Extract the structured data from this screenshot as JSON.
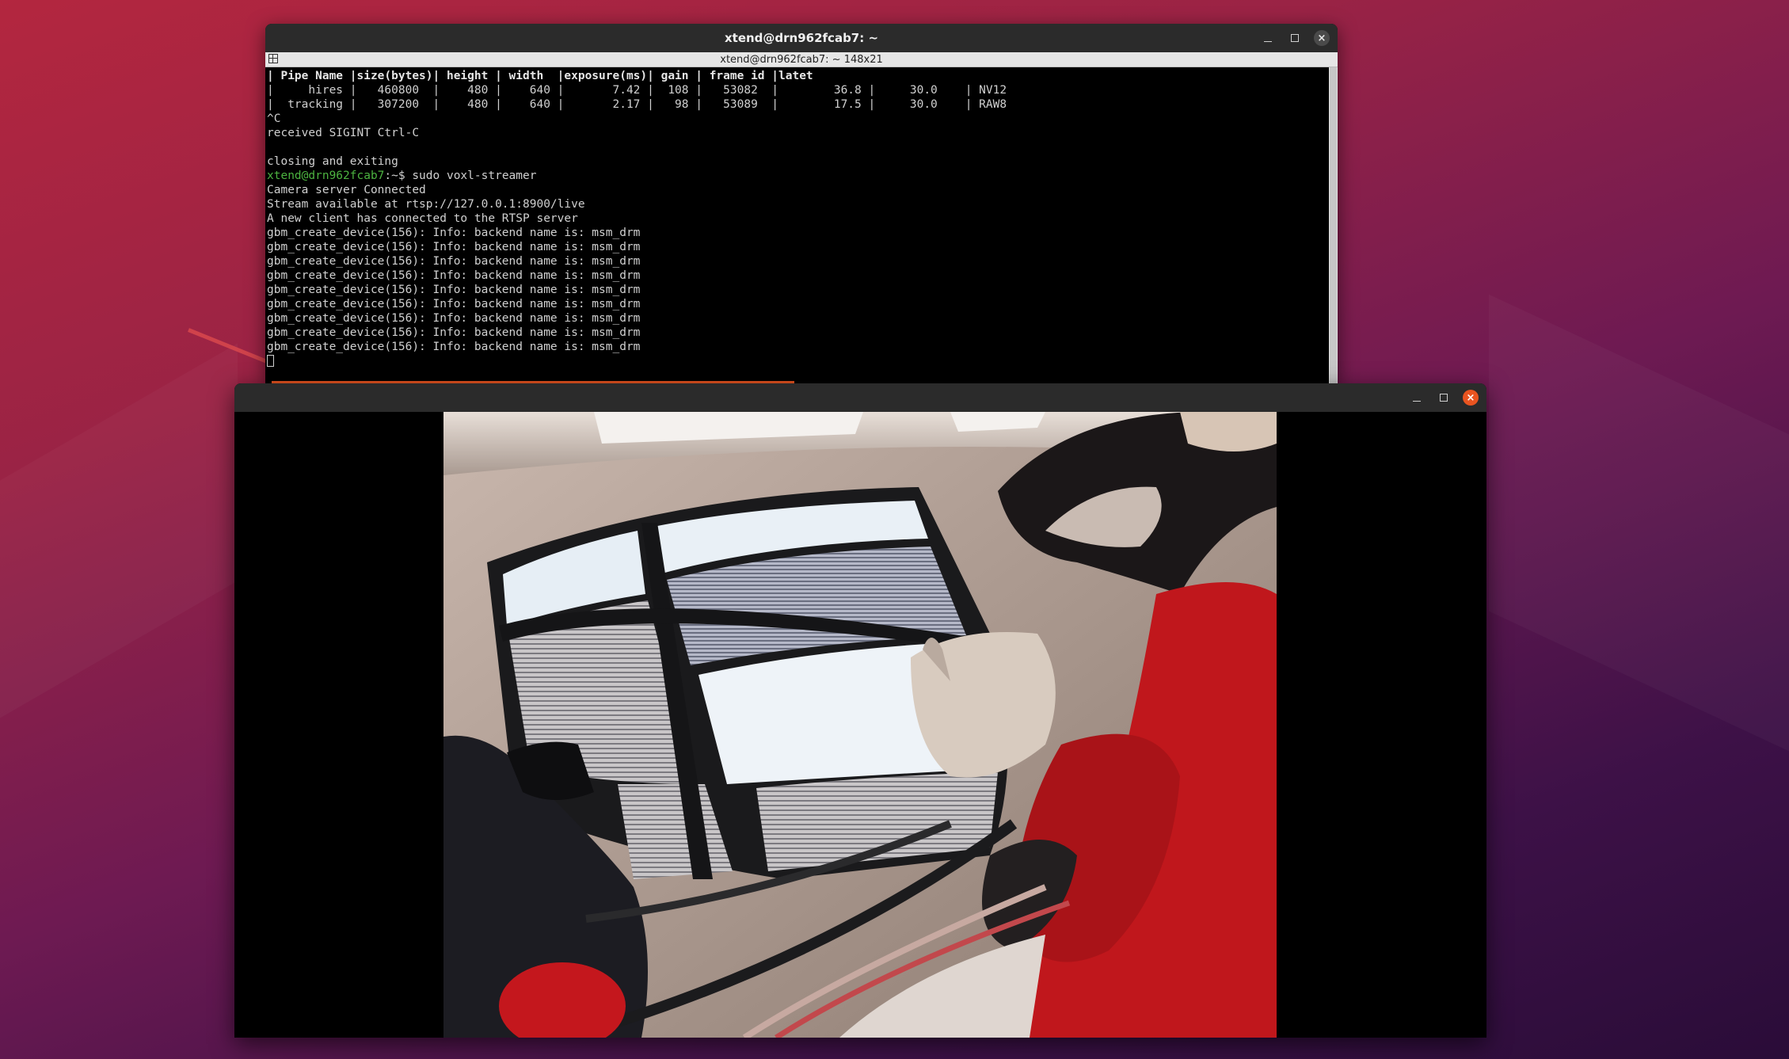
{
  "terminal": {
    "title": "xtend@drn962fcab7: ~",
    "subtitle": "xtend@drn962fcab7: ~ 148x21",
    "table_header": "| Pipe Name |size(bytes)| height | width  |exposure(ms)| gain | frame id |latet",
    "table_rows": [
      "|     hires |   460800  |    480 |    640 |       7.42 |  108 |   53082  |        36.8 |     30.0    | NV12",
      "|  tracking |   307200  |    480 |    640 |       2.17 |   98 |   53089  |        17.5 |     30.0    | RAW8"
    ],
    "lines_before_prompt": [
      "^C",
      "received SIGINT Ctrl-C",
      "",
      "closing and exiting"
    ],
    "prompt_user": "xtend@drn962fcab7",
    "prompt_suffix": ":~$ ",
    "command": "sudo voxl-streamer",
    "lines_after_prompt": [
      "Camera server Connected",
      "Stream available at rtsp://127.0.0.1:8900/live",
      "A new client has connected to the RTSP server",
      "gbm_create_device(156): Info: backend name is: msm_drm",
      "gbm_create_device(156): Info: backend name is: msm_drm",
      "gbm_create_device(156): Info: backend name is: msm_drm",
      "gbm_create_device(156): Info: backend name is: msm_drm",
      "gbm_create_device(156): Info: backend name is: msm_drm",
      "gbm_create_device(156): Info: backend name is: msm_drm",
      "gbm_create_device(156): Info: backend name is: msm_drm",
      "gbm_create_device(156): Info: backend name is: msm_drm",
      "gbm_create_device(156): Info: backend name is: msm_drm"
    ]
  },
  "video_window": {
    "title": ""
  },
  "icons": {
    "minimize": "minimize-icon",
    "maximize": "maximize-icon",
    "close": "close-icon",
    "close_glyph": "×"
  },
  "colors": {
    "accent": "#e95420",
    "prompt": "#4cb340",
    "titlebar": "#2b2b2b"
  }
}
